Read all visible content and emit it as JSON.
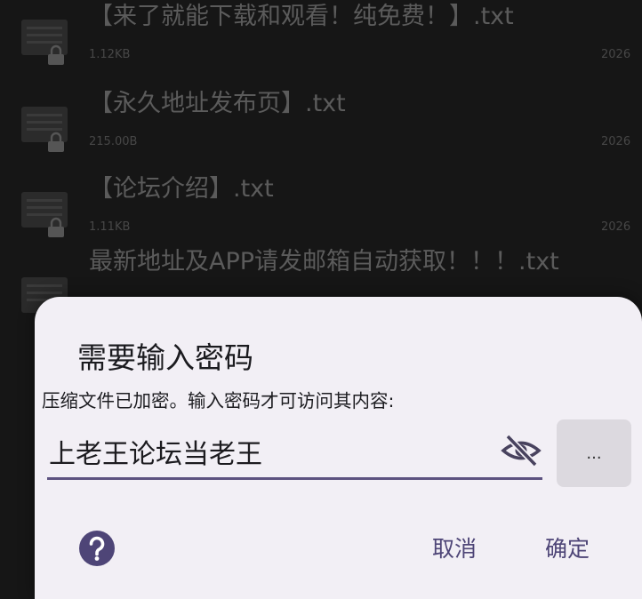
{
  "files": [
    {
      "name": "【来了就能下载和观看！纯免费！】.txt",
      "size": "1.12KB",
      "date": "2026"
    },
    {
      "name": "【永久地址发布页】.txt",
      "size": "215.00B",
      "date": "2026"
    },
    {
      "name": "【论坛介绍】.txt",
      "size": "1.11KB",
      "date": "2026"
    },
    {
      "name": "最新地址及APP请发邮箱自动获取！！！.txt",
      "size": "",
      "date": ""
    }
  ],
  "dialog": {
    "title": "需要输入密码",
    "message": "压缩文件已加密。输入密码才可访问其内容:",
    "password_value": "上老王论坛当老王",
    "more_label": "...",
    "cancel_label": "取消",
    "confirm_label": "确定"
  },
  "colors": {
    "accent": "#4e4577",
    "dialog_bg": "#f2eff5",
    "field_underline": "#5c5280",
    "backdrop": "#161616"
  },
  "icons": [
    "lock-icon",
    "visibility-off-icon",
    "help-icon"
  ]
}
